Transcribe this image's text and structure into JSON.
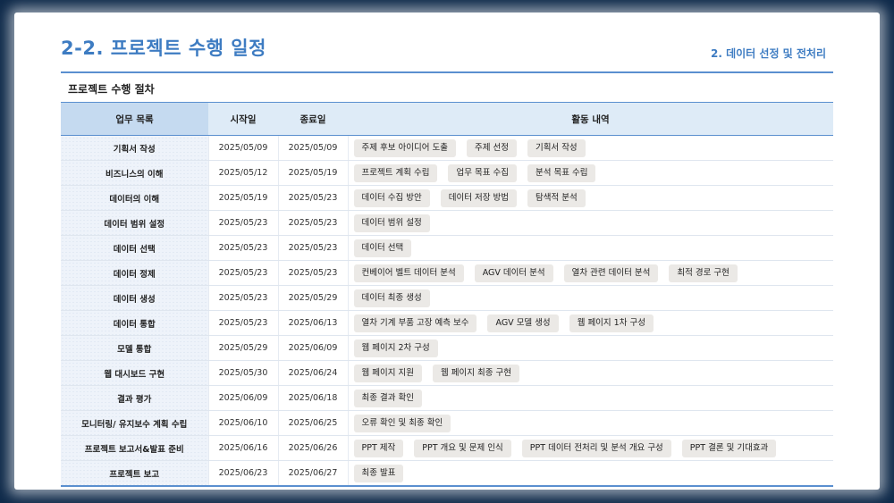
{
  "slide": {
    "title": "2-2. 프로젝트 수행 일정",
    "section": "2. 데이터 선정 및 전처리",
    "subtitle": "프로젝트 수행 절차"
  },
  "table": {
    "headers": [
      "업무 목록",
      "시작일",
      "종료일",
      "활동 내역"
    ],
    "rows": [
      {
        "task": "기획서 작성",
        "start": "2025/05/09",
        "end": "2025/05/09",
        "activities": [
          "주제 후보 아이디어 도출",
          "주제 선정",
          "기획서 작성"
        ]
      },
      {
        "task": "비즈니스의 이해",
        "start": "2025/05/12",
        "end": "2025/05/19",
        "activities": [
          "프로젝트 계획 수립",
          "업무 목표 수집",
          "분석 목표 수립"
        ]
      },
      {
        "task": "데이터의 이해",
        "start": "2025/05/19",
        "end": "2025/05/23",
        "activities": [
          "데이터 수집 방안",
          "데이터 저장 방법",
          "탐색적 분석"
        ]
      },
      {
        "task": "데이터 범위 설정",
        "start": "2025/05/23",
        "end": "2025/05/23",
        "activities": [
          "데이터 범위 설정"
        ]
      },
      {
        "task": "데이터 선택",
        "start": "2025/05/23",
        "end": "2025/05/23",
        "activities": [
          "데이터 선택"
        ]
      },
      {
        "task": "데이터 정제",
        "start": "2025/05/23",
        "end": "2025/05/23",
        "activities": [
          "컨베이어 벨트 데이터 분석",
          "AGV 데이터 분석",
          "열차 관련 데이터 분석",
          "최적 경로 구현"
        ]
      },
      {
        "task": "데이터 생성",
        "start": "2025/05/23",
        "end": "2025/05/29",
        "activities": [
          "데이터 최종 생성"
        ]
      },
      {
        "task": "데이터 통합",
        "start": "2025/05/23",
        "end": "2025/06/13",
        "activities": [
          "열차 기계 부품 고장 예측 보수",
          "AGV 모델 생성",
          "웹 페이지 1차 구성"
        ]
      },
      {
        "task": "모델 통합",
        "start": "2025/05/29",
        "end": "2025/06/09",
        "activities": [
          "웹 페이지 2차 구성"
        ]
      },
      {
        "task": "웹 대시보드 구현",
        "start": "2025/05/30",
        "end": "2025/06/24",
        "activities": [
          "웹 페이지 지원",
          "웹 페이지 최종 구현"
        ]
      },
      {
        "task": "결과 평가",
        "start": "2025/06/09",
        "end": "2025/06/18",
        "activities": [
          "최종 결과 확인"
        ]
      },
      {
        "task": "모니터링/ 유지보수 계획 수립",
        "start": "2025/06/10",
        "end": "2025/06/25",
        "activities": [
          "오류 확인 및 최종 확인"
        ]
      },
      {
        "task": "프로젝트 보고서&발표 준비",
        "start": "2025/06/16",
        "end": "2025/06/26",
        "activities": [
          "PPT 제작",
          "PPT 개요 및 문제 인식",
          "PPT 데이터 전처리 및 분석 개요 구성",
          "PPT 결론 및 기대효과"
        ]
      },
      {
        "task": "프로젝트 보고",
        "start": "2025/06/23",
        "end": "2025/06/27",
        "activities": [
          "최종 발표"
        ]
      }
    ]
  }
}
